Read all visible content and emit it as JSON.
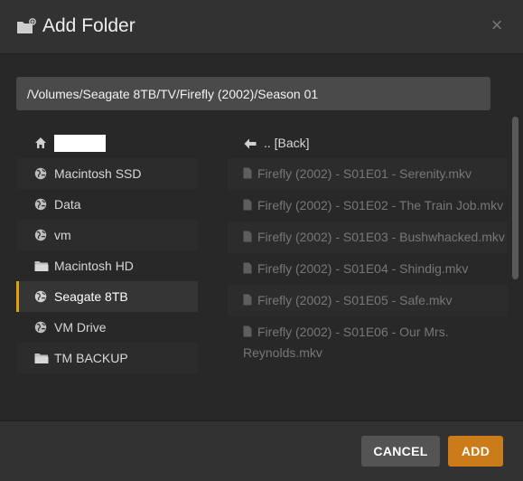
{
  "dialog": {
    "title": "Add Folder",
    "close_glyph": "×",
    "header_icon": "folder-add-icon"
  },
  "path": {
    "value": "/Volumes/Seagate 8TB/TV/Firefly (2002)/Season 01"
  },
  "sidebar": {
    "items": [
      {
        "label": "",
        "icon": "home-icon"
      },
      {
        "label": "Macintosh SSD",
        "icon": "globe-icon"
      },
      {
        "label": "Data",
        "icon": "globe-icon"
      },
      {
        "label": "vm",
        "icon": "globe-icon"
      },
      {
        "label": "Macintosh HD",
        "icon": "folder-icon"
      },
      {
        "label": "Seagate 8TB",
        "icon": "globe-icon",
        "selected": true
      },
      {
        "label": "VM Drive",
        "icon": "globe-icon"
      },
      {
        "label": "TM BACKUP",
        "icon": "folder-icon"
      }
    ]
  },
  "files": {
    "back_label": ".. [Back]",
    "items": [
      "Firefly (2002) - S01E01 - Serenity.mkv",
      "Firefly (2002) - S01E02 - The Train Job.mkv",
      "Firefly (2002) - S01E03 - Bushwhacked.mkv",
      "Firefly (2002) - S01E04 - Shindig.mkv",
      "Firefly (2002) - S01E05 - Safe.mkv",
      "Firefly (2002) - S01E06 - Our Mrs. Reynolds.mkv"
    ]
  },
  "footer": {
    "cancel_label": "CANCEL",
    "add_label": "ADD"
  },
  "colors": {
    "accent": "#e5a00d",
    "add_button": "#cc7b19",
    "cancel_button": "#545454"
  }
}
